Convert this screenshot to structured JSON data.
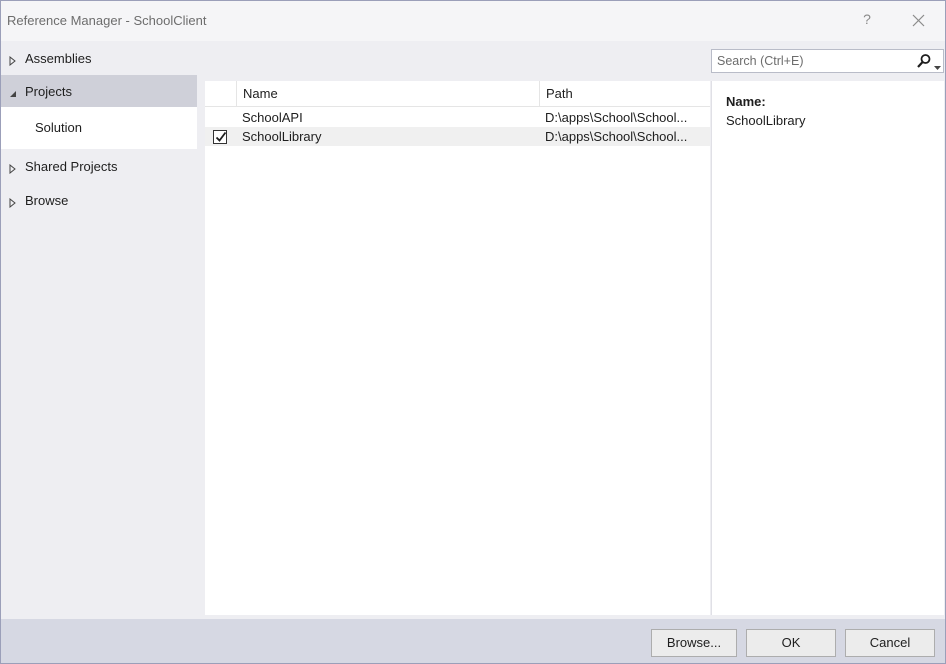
{
  "window": {
    "title": "Reference Manager - SchoolClient",
    "help_label": "?"
  },
  "nav": {
    "items": [
      {
        "label": "Assemblies",
        "expanded": false
      },
      {
        "label": "Projects",
        "expanded": true,
        "selected": true
      },
      {
        "label": "Solution",
        "sub": true
      },
      {
        "label": "Shared Projects",
        "expanded": false
      },
      {
        "label": "Browse",
        "expanded": false
      }
    ]
  },
  "search": {
    "placeholder": "Search (Ctrl+E)",
    "value": ""
  },
  "list": {
    "columns": [
      "Name",
      "Path"
    ],
    "rows": [
      {
        "name": "SchoolAPI",
        "path": "D:\\apps\\School\\School...",
        "checked": false
      },
      {
        "name": "SchoolLibrary",
        "path": "D:\\apps\\School\\School...",
        "checked": true
      }
    ]
  },
  "details": {
    "label": "Name:",
    "value": "SchoolLibrary"
  },
  "buttons": {
    "browse": "Browse...",
    "ok": "OK",
    "cancel": "Cancel"
  },
  "colors": {
    "selected_nav": "#cfd0d9",
    "footer": "#d6d8e3",
    "window_bg": "#eeeef2"
  }
}
